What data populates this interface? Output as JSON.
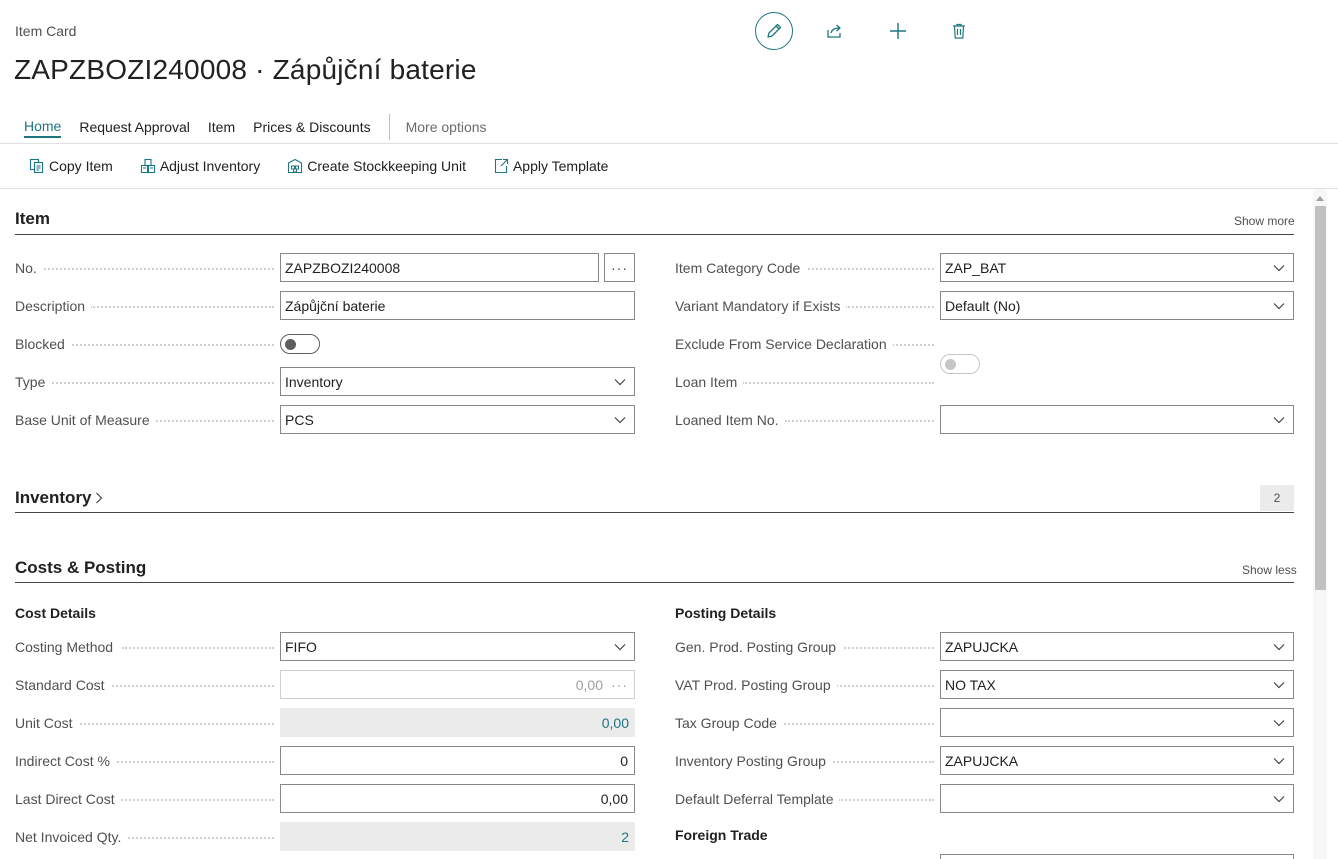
{
  "header": {
    "caption": "Item Card",
    "title": "ZAPZBOZI240008 · Zápůjční baterie"
  },
  "tabs": [
    {
      "label": "Home"
    },
    {
      "label": "Request Approval"
    },
    {
      "label": "Item"
    },
    {
      "label": "Prices & Discounts"
    },
    {
      "label": "More options"
    }
  ],
  "actions": [
    {
      "label": "Copy Item",
      "icon": "copy-icon"
    },
    {
      "label": "Adjust Inventory",
      "icon": "adjust-inventory-icon"
    },
    {
      "label": "Create Stockkeeping Unit",
      "icon": "stockkeeping-unit-icon"
    },
    {
      "label": "Apply Template",
      "icon": "apply-template-icon"
    }
  ],
  "item": {
    "title": "Item",
    "show_more": "Show more",
    "no_label": "No.",
    "no_value": "ZAPZBOZI240008",
    "description_label": "Description",
    "description_value": "Zápůjční baterie",
    "blocked_label": "Blocked",
    "blocked_value": false,
    "type_label": "Type",
    "type_value": "Inventory",
    "base_uom_label": "Base Unit of Measure",
    "base_uom_value": "PCS",
    "item_category_label": "Item Category Code",
    "item_category_value": "ZAP_BAT",
    "variant_mandatory_label": "Variant Mandatory if Exists",
    "variant_mandatory_value": "Default (No)",
    "exclude_service_label": "Exclude From Service Declaration",
    "exclude_service_value": false,
    "loan_item_label": "Loan Item",
    "loan_item_value": true,
    "loaned_item_no_label": "Loaned Item No.",
    "loaned_item_no_value": ""
  },
  "inventory": {
    "title": "Inventory",
    "count": "2"
  },
  "costs": {
    "title": "Costs & Posting",
    "show_less": "Show less",
    "cost_details_title": "Cost Details",
    "costing_method_label": "Costing Method",
    "costing_method_value": "FIFO",
    "standard_cost_label": "Standard Cost",
    "standard_cost_value": "0,00",
    "unit_cost_label": "Unit Cost",
    "unit_cost_value": "0,00",
    "indirect_cost_label": "Indirect Cost %",
    "indirect_cost_value": "0",
    "last_direct_cost_label": "Last Direct Cost",
    "last_direct_cost_value": "0,00",
    "net_invoiced_qty_label": "Net Invoiced Qty.",
    "net_invoiced_qty_value": "2",
    "posting_details_title": "Posting Details",
    "gen_prod_label": "Gen. Prod. Posting Group",
    "gen_prod_value": "ZAPUJCKA",
    "vat_prod_label": "VAT Prod. Posting Group",
    "vat_prod_value": "NO TAX",
    "tax_group_label": "Tax Group Code",
    "tax_group_value": "",
    "inventory_posting_label": "Inventory Posting Group",
    "inventory_posting_value": "ZAPUJCKA",
    "deferral_label": "Default Deferral Template",
    "deferral_value": "",
    "foreign_trade_title": "Foreign Trade"
  },
  "colors": {
    "accent": "#1d7680",
    "text": "#212121",
    "label": "#505050",
    "readonly_bg": "#ebebeb"
  }
}
